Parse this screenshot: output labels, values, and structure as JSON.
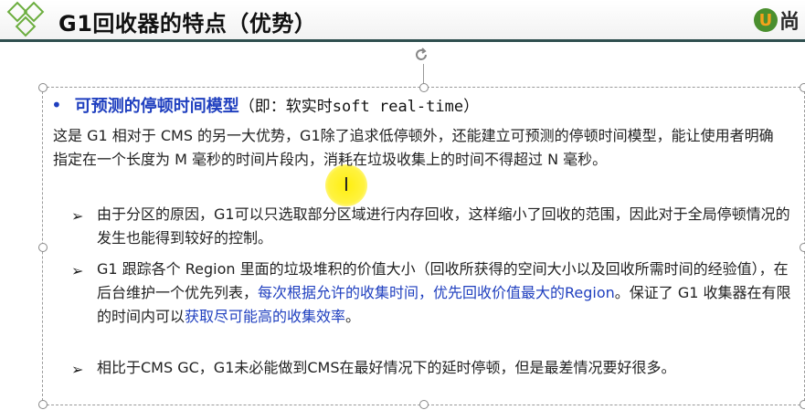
{
  "header": {
    "title": "G1回收器的特点（优势）",
    "brand": "尚"
  },
  "lead": {
    "bullet": "•",
    "strong": "可预测的停顿时间模型",
    "rest": "（即：软实时soft real-time）"
  },
  "body": {
    "paragraph": "这是 G1 相对于 CMS 的另一大优势，G1除了追求低停顿外，还能建立可预测的停顿时间模型，能让使用者明确指定在一个长度为 M 毫秒的时间片段内，消耗在垃圾收集上的时间不得超过 N 毫秒。"
  },
  "points": [
    {
      "text": "由于分区的原因，G1可以只选取部分区域进行内存回收，这样缩小了回收的范围，因此对于全局停顿情况的发生也能得到较好的控制。"
    },
    {
      "text_a": "G1 跟踪各个 Region 里面的垃圾堆积的价值大小（回收所获得的空间大小以及回收所需时间的经验值），在后台维护一个优先列表，",
      "text_highlight": "每次根据允许的收集时间，优先回收价值最大的Region",
      "text_b": "。保证了 G1 收集器在有限的时间内可以",
      "text_highlight2": "获取尽可能高的收集效率",
      "text_c": "。"
    },
    {
      "text": "相比于CMS GC，G1未必能做到CMS在最好情况下的延时停顿，但是最差情况要好很多。"
    }
  ],
  "colors": {
    "accent_blue": "#1f3fbf",
    "header_line": "#2f4f4f",
    "cursor_highlight": "#ffee00"
  },
  "icons": {
    "arrow": "➢",
    "rotate": "rotate-handle-icon",
    "ibeam": "I"
  }
}
